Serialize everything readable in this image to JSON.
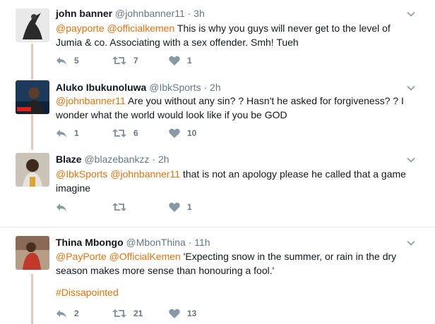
{
  "colors": {
    "accent": "#e8710a",
    "muted": "#657786",
    "text": "#14171a",
    "thread": "#e6c8b8",
    "divider": "#e6ecf0"
  },
  "tweets": [
    {
      "name": "john banner",
      "handle": "@johnbanner11",
      "dot": "·",
      "time": "3h",
      "mention1": "@payporte",
      "mention2": "@officialkemen",
      "body": "This is why you guys will never get to the level of Jumia & co. Associating with a sex offender. Smh! Tueh",
      "replies": "5",
      "retweets": "7",
      "likes": "1"
    },
    {
      "name": "Aluko Ibukunoluwa",
      "handle": "@IbkSports",
      "dot": "·",
      "time": "2h",
      "mention1": "@johnbanner11",
      "body": "Are you without any sin? ? Hasn't he asked for forgiveness? ? I wonder what the world would look like if you be GOD",
      "replies": "1",
      "retweets": "6",
      "likes": "10"
    },
    {
      "name": "Blaze",
      "handle": "@blazebankzz",
      "dot": "·",
      "time": "2h",
      "mention1": "@IbkSports",
      "mention2": "@johnbanner11",
      "body": "that is not an apology please he called that a game imagine",
      "replies": "",
      "retweets": "",
      "likes": "1"
    },
    {
      "name": "Thina Mbongo",
      "handle": "@MbonThina",
      "dot": "·",
      "time": "11h",
      "mention1": "@PayPorte",
      "mention2": "@OfficialKemen",
      "body": "'Expecting snow in the summer, or rain in the dry season makes more sense than honouring a fool.'",
      "hashtag": "#Dissapointed",
      "replies": "2",
      "retweets": "21",
      "likes": "13"
    }
  ],
  "icons": {
    "reply": "reply-icon",
    "retweet": "retweet-icon",
    "like": "heart-icon",
    "more": "chevron-down-icon"
  }
}
